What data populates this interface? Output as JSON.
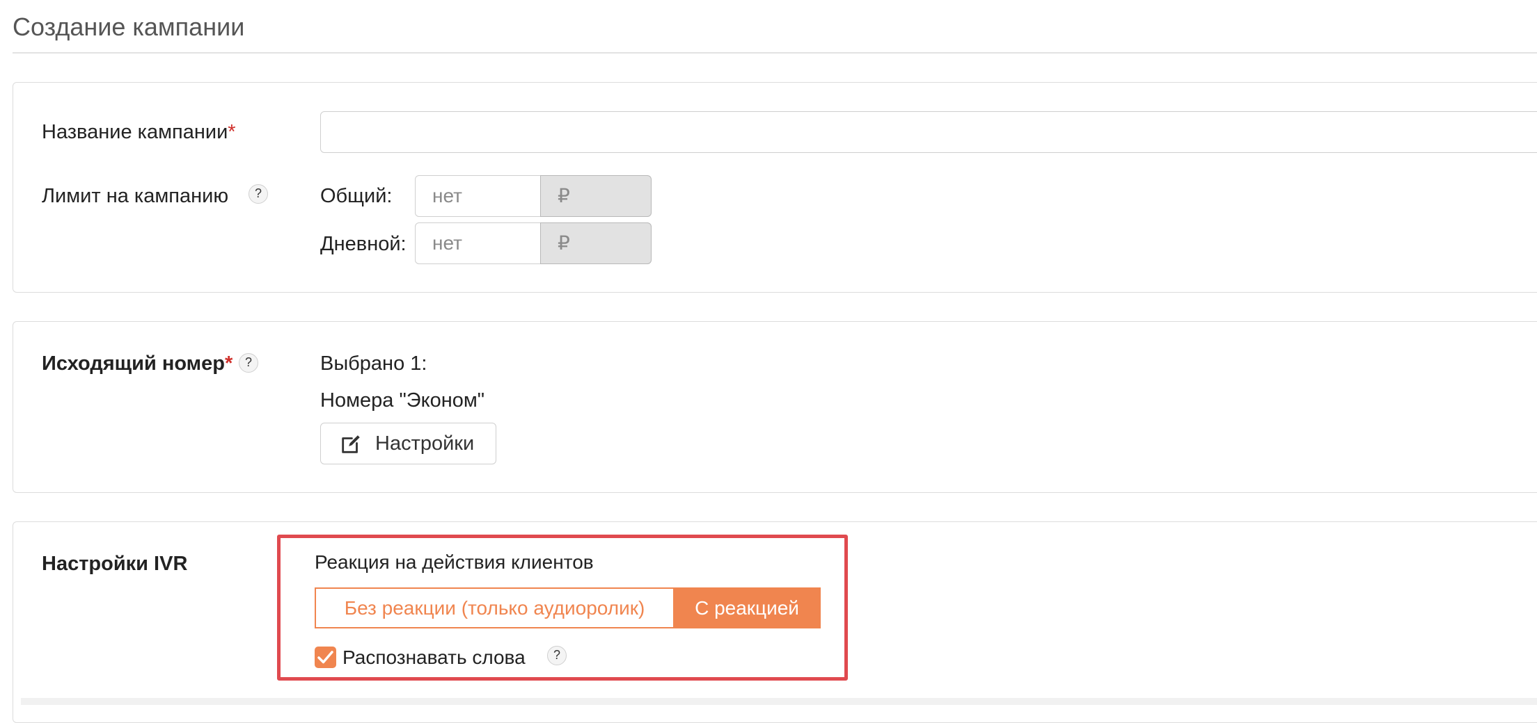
{
  "page": {
    "title": "Создание кампании"
  },
  "campaign": {
    "name_label": "Название кампании",
    "required_mark": "*",
    "name_value": "",
    "limit_label": "Лимит на кампанию",
    "help_text": "?",
    "total_label": "Общий:",
    "total_placeholder": "нет",
    "daily_label": "Дневной:",
    "daily_placeholder": "нет",
    "currency": "₽"
  },
  "outgoing": {
    "label": "Исходящий номер",
    "required_mark": "*",
    "help_text": "?",
    "selected_text": "Выбрано 1:",
    "numbers_text": "Номера \"Эконом\"",
    "settings_button": "Настройки",
    "settings_icon": "edit-icon"
  },
  "ivr": {
    "label": "Настройки IVR",
    "reaction_title": "Реакция на действия клиентов",
    "options": [
      "Без реакции (только аудиоролик)",
      "С реакцией"
    ],
    "selected_option": "С реакцией",
    "recognize_label": "Распознавать слова",
    "recognize_checked": true,
    "help_text": "?"
  },
  "colors": {
    "accent": "#f0854f",
    "highlight": "#e04a4f",
    "required": "#d0302b"
  }
}
